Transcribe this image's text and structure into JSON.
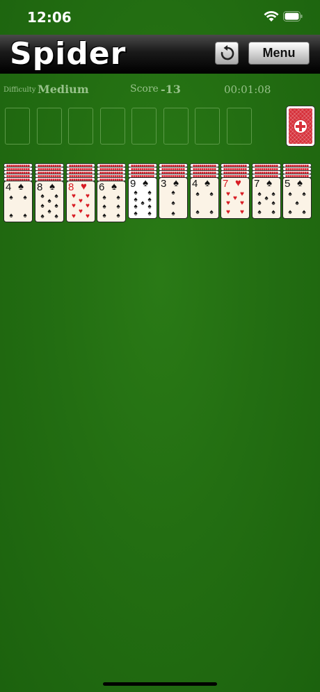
{
  "status_bar": {
    "time": "12:06"
  },
  "header": {
    "title": "Spider",
    "menu_label": "Menu"
  },
  "info": {
    "difficulty_label": "Difficulty",
    "difficulty_value": "Medium",
    "score_label": "Score",
    "score_value": "-13",
    "timer": "00:01:08"
  },
  "foundations_empty": 8,
  "stock": {
    "face": "down"
  },
  "tableau": [
    {
      "hidden": 5,
      "rank": "4",
      "suit": "♠",
      "color": "black"
    },
    {
      "hidden": 5,
      "rank": "8",
      "suit": "♠",
      "color": "black"
    },
    {
      "hidden": 5,
      "rank": "8",
      "suit": "♥",
      "color": "red"
    },
    {
      "hidden": 5,
      "rank": "6",
      "suit": "♠",
      "color": "black"
    },
    {
      "hidden": 4,
      "rank": "9",
      "suit": "♠",
      "color": "black"
    },
    {
      "hidden": 4,
      "rank": "3",
      "suit": "♠",
      "color": "black"
    },
    {
      "hidden": 4,
      "rank": "4",
      "suit": "♠",
      "color": "black"
    },
    {
      "hidden": 4,
      "rank": "7",
      "suit": "♥",
      "color": "red"
    },
    {
      "hidden": 4,
      "rank": "7",
      "suit": "♠",
      "color": "black"
    },
    {
      "hidden": 4,
      "rank": "5",
      "suit": "♠",
      "color": "black"
    }
  ],
  "colors": {
    "felt": "#236e12",
    "card_back": "#d6303a",
    "accent_text": "#97c28a"
  }
}
